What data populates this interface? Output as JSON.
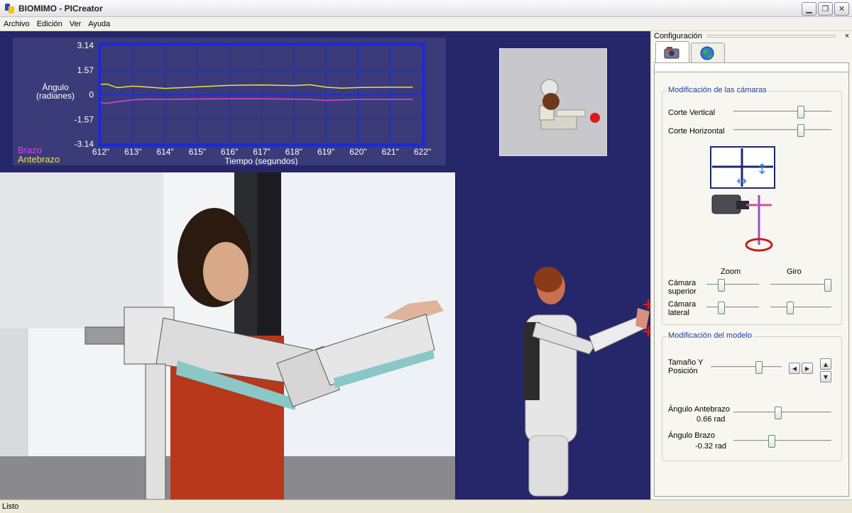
{
  "window": {
    "title": "BIOMIMO  - PICreator"
  },
  "menu": {
    "items": [
      "Archivo",
      "Edición",
      "Ver",
      "Ayuda"
    ]
  },
  "chart": {
    "legend_brazo": "Brazo",
    "legend_antebrazo": "Antebrazo",
    "ylabel_line1": "Ángulo",
    "ylabel_line2": "(radianes)",
    "xlabel": "Tiempo (segundos)",
    "y_ticks": [
      "3.14",
      "1.57",
      "0",
      "-1.57",
      "-3.14"
    ],
    "x_ticks": [
      "612\"",
      "613\"",
      "614\"",
      "615\"",
      "616\"",
      "617\"",
      "618\"",
      "619\"",
      "620\"",
      "621\"",
      "622\""
    ]
  },
  "chart_data": {
    "type": "line",
    "ylabel": "Ángulo (radianes)",
    "xlabel": "Tiempo (segundos)",
    "xlim": [
      612,
      622
    ],
    "ylim": [
      -3.14,
      3.14
    ],
    "grid": true,
    "legend": "bottom-left",
    "x": [
      612,
      612.2,
      612.5,
      613,
      613.5,
      614,
      615,
      616,
      617,
      618,
      618.5,
      619,
      619.5,
      620,
      621,
      621.7
    ],
    "series": [
      {
        "name": "Antebrazo",
        "color": "#f0e040",
        "values": [
          0.66,
          0.68,
          0.45,
          0.55,
          0.48,
          0.4,
          0.5,
          0.6,
          0.62,
          0.58,
          0.64,
          0.48,
          0.42,
          0.46,
          0.48,
          0.48
        ]
      },
      {
        "name": "Brazo",
        "color": "#e040e8",
        "values": [
          -0.5,
          -0.55,
          -0.45,
          -0.32,
          -0.28,
          -0.3,
          -0.27,
          -0.26,
          -0.26,
          -0.28,
          -0.3,
          -0.36,
          -0.33,
          -0.3,
          -0.3,
          -0.3
        ]
      }
    ]
  },
  "config": {
    "title": "Configuración",
    "close": "×",
    "camaras": {
      "title": "Modificación de las cámaras",
      "corte_vertical": "Corte Vertical",
      "corte_horizontal": "Corte Horizontal",
      "zoom": "Zoom",
      "giro": "Giro",
      "camara_superior_1": "Cámara",
      "camara_superior_2": "superior",
      "camara_lateral_1": "Cámara",
      "camara_lateral_2": "lateral"
    },
    "modelo": {
      "title": "Modificación del modelo",
      "tamano_1": "Tamaño Y",
      "tamano_2": "Posición",
      "angulo_antebrazo": "Ángulo Antebrazo",
      "angulo_antebrazo_value": "0.66 rad",
      "angulo_brazo": "Ángulo Brazo",
      "angulo_brazo_value": "-0.32 rad"
    }
  },
  "sliders": {
    "corte_vertical": 0.7,
    "corte_horizontal": 0.7,
    "zoom_superior": 0.25,
    "giro_superior": 1.0,
    "zoom_lateral": 0.25,
    "giro_lateral": 0.3,
    "tamano": 0.7,
    "angulo_antebrazo": 0.45,
    "angulo_brazo": 0.38
  },
  "status": {
    "text": "Listo"
  }
}
